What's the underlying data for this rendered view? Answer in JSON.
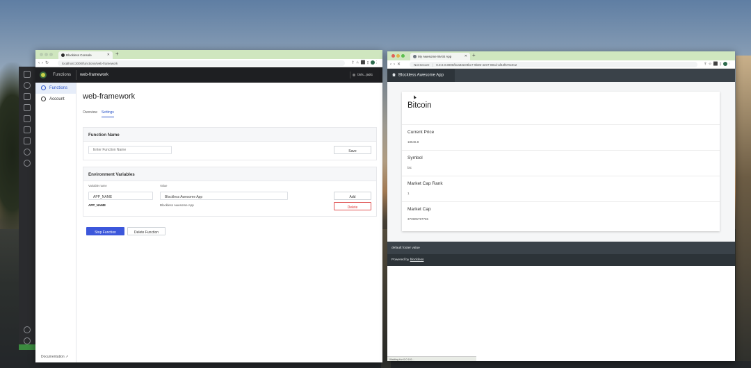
{
  "left_browser": {
    "tab_title": "Blockless Console",
    "url": "localhost:3000/functions/web-framework",
    "console": {
      "nav_functions": "Functions",
      "nav_project": "web-framework",
      "user": "bhfs...j9dG",
      "sidebar": [
        {
          "label": "Functions",
          "icon": "functions-icon",
          "active": true
        },
        {
          "label": "Account",
          "icon": "account-icon",
          "active": false
        }
      ],
      "documentation": "Documentation ↗",
      "title": "web-framework",
      "tabs": [
        "Overview",
        "Settings"
      ],
      "active_tab": "Settings",
      "function_name": {
        "heading": "Function Name",
        "placeholder": "Enter Function Name",
        "save": "Save"
      },
      "env": {
        "heading": "Environment Variables",
        "col_name": "Variable name",
        "col_value": "Value",
        "name_value": "APP_NAME",
        "value_value": "Blockless Awesome App",
        "add": "Add",
        "rows": [
          {
            "name": "APP_NAME",
            "value": "Blockless Awesome App",
            "action": "Delete"
          }
        ]
      },
      "stop_function": "Stop Function",
      "delete_function": "Delete Function"
    }
  },
  "right_browser": {
    "tab_title": "My Awesome WASI App",
    "security": "Not Secure",
    "url": "0.0.0.0:3000/bca93ee9bc7-9b06-4e07-89cd-af43f576c9c2",
    "app": {
      "brand": "Blockless Awesome App",
      "heading": "Bitcoin",
      "fields": [
        {
          "label": "Current Price",
          "value": "18546.8"
        },
        {
          "label": "Symbol",
          "value": "btc"
        },
        {
          "label": "Market Cap Rank",
          "value": "1"
        },
        {
          "label": "Market Cap",
          "value": "373905797765"
        }
      ],
      "footer_value": "default footer value",
      "powered_by_prefix": "Powered by",
      "powered_by_link": "blockless",
      "status": "Waiting for 0.0.0.0..."
    }
  }
}
